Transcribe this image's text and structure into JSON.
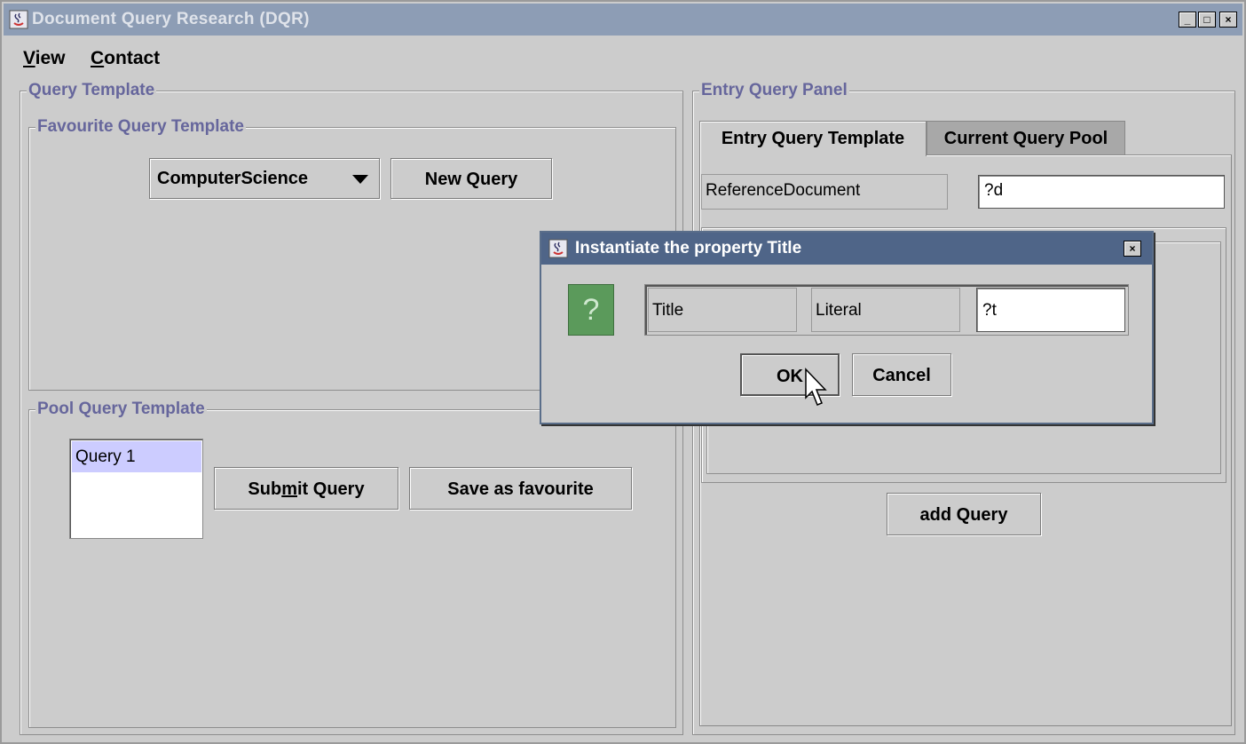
{
  "window": {
    "title": "Document Query Research (DQR)",
    "controls": {
      "minimize": "_",
      "maximize": "□",
      "close": "×"
    }
  },
  "menu": {
    "items": [
      {
        "label": "View",
        "mnemonic": "V",
        "rest": "iew"
      },
      {
        "label": "Contact",
        "mnemonic": "C",
        "rest": "ontact"
      }
    ]
  },
  "query_template": {
    "title": "Query Template",
    "favourite": {
      "title": "Favourite Query Template",
      "combo_value": "ComputerScience",
      "new_query_label": "New Query"
    },
    "pool": {
      "title": "Pool Query Template",
      "list_items": [
        "Query 1"
      ],
      "selected_index": 0,
      "submit_label_pre": "Sub",
      "submit_label_mn": "m",
      "submit_label_post": "it Query",
      "save_label": "Save as favourite"
    }
  },
  "entry_panel": {
    "title": "Entry Query Panel",
    "tabs": [
      {
        "label": "Entry Query Template",
        "active": true
      },
      {
        "label": "Current Query Pool",
        "active": false
      }
    ],
    "reference_label": "ReferenceDocument",
    "reference_value": "?d",
    "add_query_label": "add Query"
  },
  "dialog": {
    "title": "Instantiate the property Title",
    "icon": "question-icon",
    "property": "Title",
    "type": "Literal",
    "value": "?t",
    "ok_label": "OK",
    "cancel_label": "Cancel"
  },
  "colors": {
    "titlebar": "#8d9db5",
    "dialog_titlebar": "#4f6588",
    "border_title": "#66669c",
    "selection": "#ccccff",
    "question_icon_bg": "#5b9a5b"
  }
}
